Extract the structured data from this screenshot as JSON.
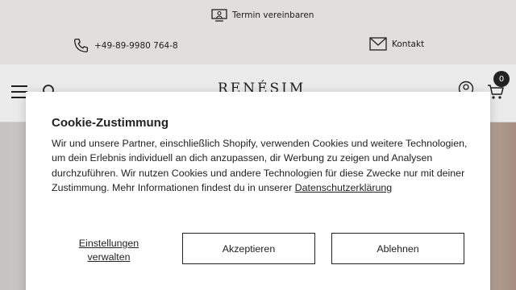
{
  "topbar": {
    "appointment_label": "Termin vereinbaren",
    "phone": "+49-89-9980 764-8",
    "contact_label": "Kontakt"
  },
  "header": {
    "logo_text": "RENÉSIM",
    "cart_count": "0"
  },
  "cookie_dialog": {
    "title": "Cookie-Zustimmung",
    "body": "Wir und unsere Partner, einschließlich Shopify, verwenden Cookies und weitere Technologien, um dein Erlebnis individuell an dich anzupassen, dir Werbung zu zeigen und Analysen durchzuführen. Wir nutzen Cookies und andere Technologien für diese Zwecke nur mit deiner Zustimmung. Mehr Informationen findest du in unserer",
    "privacy_link": "Datenschutzerklärung",
    "settings_label": "Einstellungen verwalten",
    "accept_label": "Akzeptieren",
    "decline_label": "Ablehnen"
  }
}
